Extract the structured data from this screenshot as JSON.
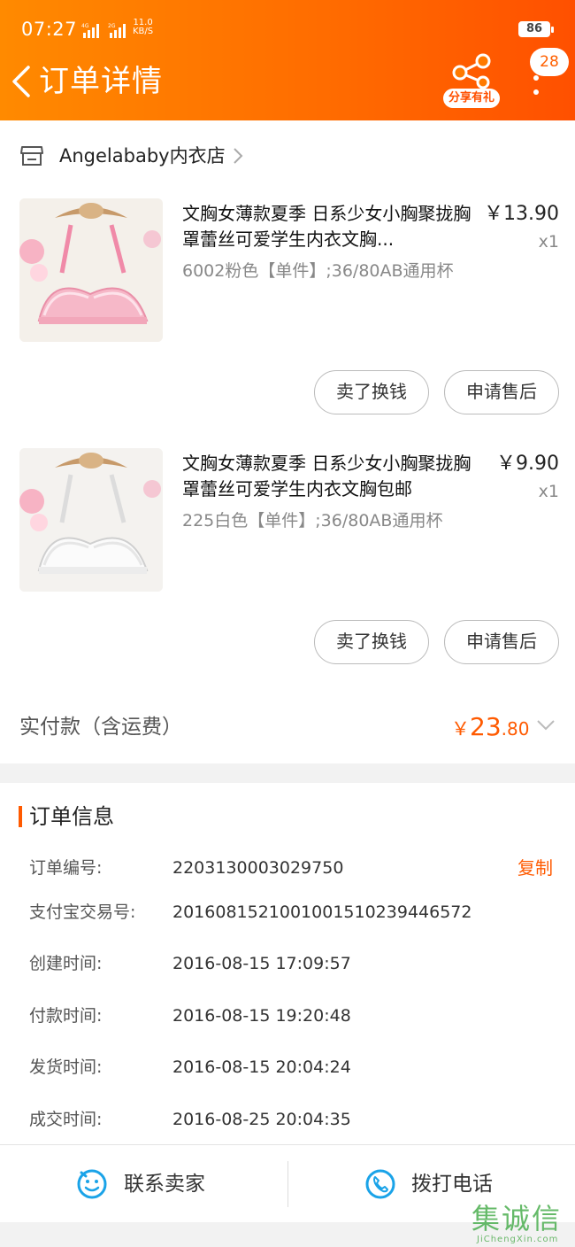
{
  "status_bar": {
    "time": "07:27",
    "net_speed": "11.0",
    "net_unit": "KB/S",
    "battery": "86"
  },
  "header": {
    "title": "订单详情",
    "share_label": "分享有礼",
    "badge_count": "28",
    "brand_color": "#ff6a00"
  },
  "shop": {
    "name": "Angelababy内衣店"
  },
  "items": [
    {
      "title": "文胸女薄款夏季 日系少女小胸聚拢胸罩蕾丝可爱学生内衣文胸...",
      "price": "￥13.90",
      "qty": "x1",
      "spec": "6002粉色【单件】;36/80AB通用杯",
      "sell_button": "卖了换钱",
      "after_sale_button": "申请售后",
      "color": "pink"
    },
    {
      "title": "文胸女薄款夏季 日系少女小胸聚拢胸罩蕾丝可爱学生内衣文胸包邮",
      "price": "￥9.90",
      "qty": "x1",
      "spec": "225白色【单件】;36/80AB通用杯",
      "sell_button": "卖了换钱",
      "after_sale_button": "申请售后",
      "color": "white"
    }
  ],
  "payment": {
    "label": "实付款（含运费）",
    "currency": "￥",
    "amount_int": "23",
    "amount_dec": ".80"
  },
  "order_info": {
    "title": "订单信息",
    "copy_label": "复制",
    "rows": [
      {
        "key": "订单编号:",
        "value": "2203130003029750"
      },
      {
        "key": "支付宝交易号:",
        "value": "2016081521001001510239446572"
      },
      {
        "key": "创建时间:",
        "value": "2016-08-15 17:09:57"
      },
      {
        "key": "付款时间:",
        "value": "2016-08-15 19:20:48"
      },
      {
        "key": "发货时间:",
        "value": "2016-08-15 20:04:24"
      },
      {
        "key": "成交时间:",
        "value": "2016-08-25 20:04:35"
      }
    ]
  },
  "bottom_bar": {
    "contact_seller": "联系卖家",
    "call_phone": "拨打电话"
  },
  "watermark": {
    "chars": "集诚信",
    "url": "JiChengXin.com"
  }
}
